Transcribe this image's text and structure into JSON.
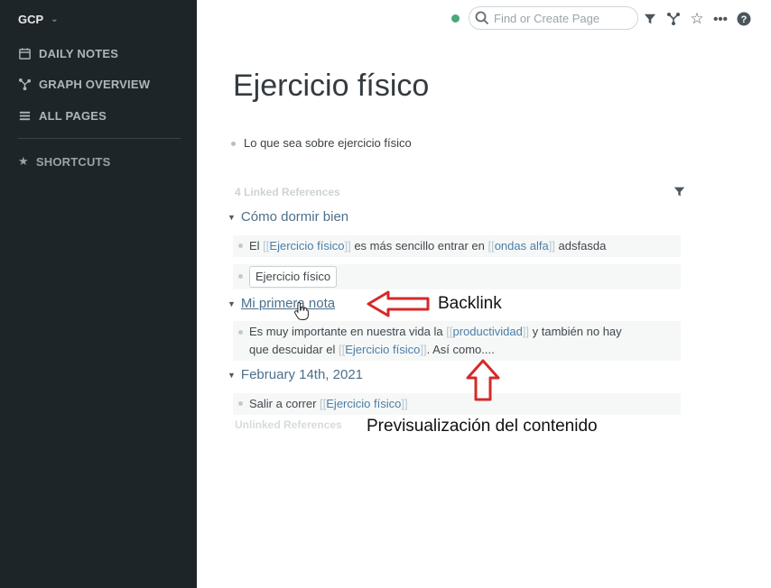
{
  "sidebar": {
    "graph_name": "GCP",
    "items": [
      {
        "label": "DAILY NOTES",
        "icon": "calendar-icon"
      },
      {
        "label": "GRAPH OVERVIEW",
        "icon": "graph-icon"
      },
      {
        "label": "ALL PAGES",
        "icon": "list-icon"
      },
      {
        "label": "SHORTCUTS",
        "icon": "star-icon"
      }
    ]
  },
  "topbar": {
    "search_placeholder": "Find or Create Page",
    "icons": [
      "filter-icon",
      "graph-icon",
      "star-icon",
      "more-icon",
      "help-icon"
    ]
  },
  "page": {
    "title": "Ejercicio físico",
    "root_block": "Lo que sea sobre ejercicio físico",
    "linked_header": "4 Linked References",
    "unlinked_header": "Unlinked References",
    "refs": [
      {
        "title": "Cómo dormir bien",
        "b1": {
          "t1": "El ",
          "l1": "Ejercicio físico",
          "t2": " es más sencillo entrar en ",
          "l2": "ondas alfa",
          "t3": " adsfasda"
        },
        "b2_embed": "Ejercicio físico"
      },
      {
        "title": "Mi primera nota",
        "b1": {
          "t1": "Es muy importante en nuestra vida la ",
          "l1": "productividad",
          "t2": " y también no hay",
          "t3": "que descuidar el ",
          "l2": "Ejercicio físico",
          "t4": ". Así como...."
        }
      },
      {
        "title": "February 14th, 2021",
        "b1": {
          "t1": "Salir a correr ",
          "l1": "Ejercicio físico"
        }
      }
    ]
  },
  "annotations": {
    "backlink": "Backlink",
    "preview": "Previsualización del contenido",
    "arrow_color": "#d42a2a"
  },
  "colors": {
    "sidebar_bg": "#1e2529",
    "link": "#4b7ea6",
    "status_dot": "#4aa87b"
  }
}
